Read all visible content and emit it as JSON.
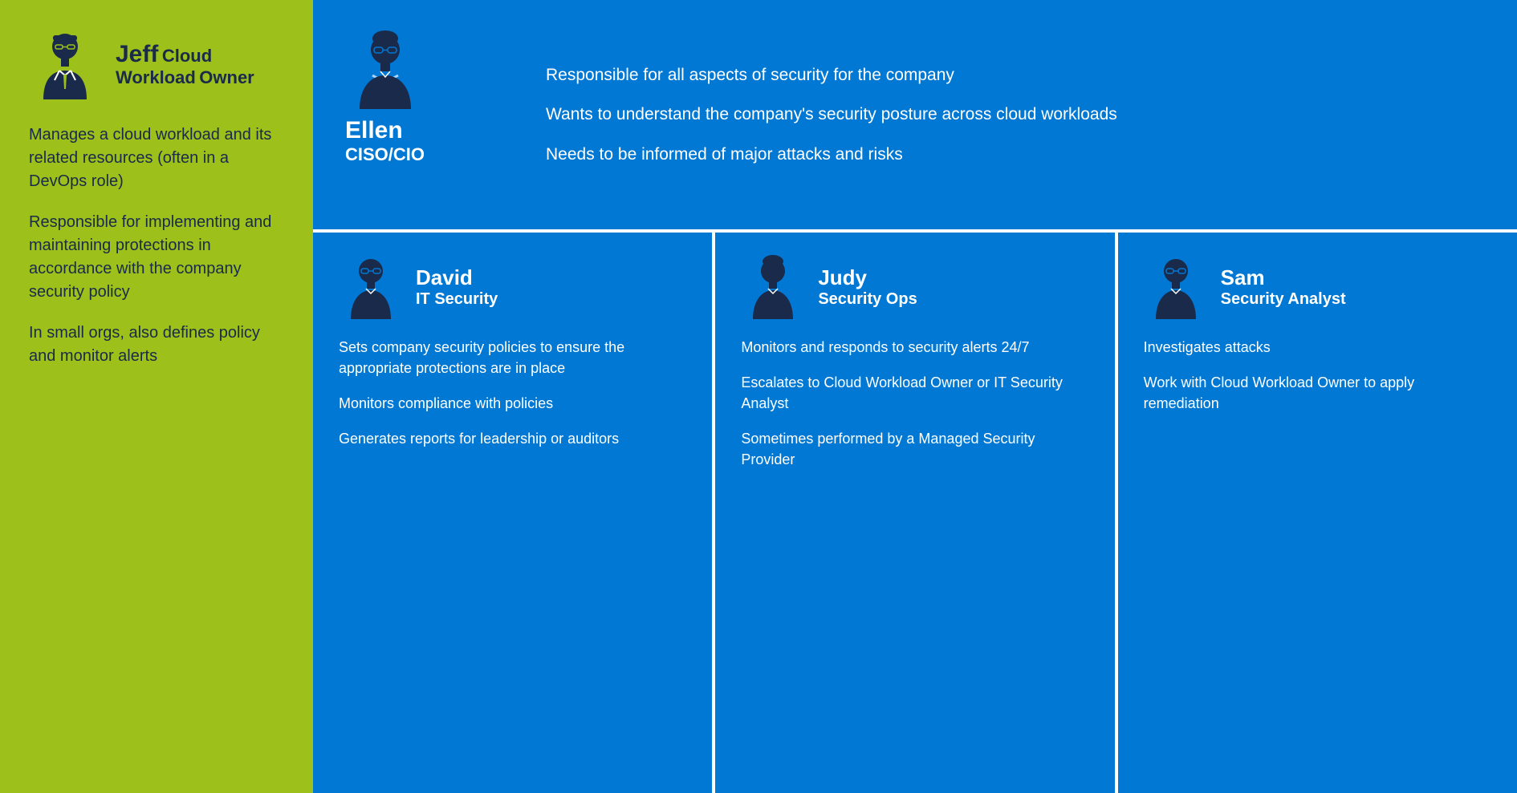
{
  "jeff": {
    "name": "Jeff",
    "role_line1": "Cloud Workload",
    "role_line2": "Owner",
    "desc1": "Manages a cloud workload and its related resources (often in a DevOps role)",
    "desc2": "Responsible for implementing and maintaining protections in accordance with the company security policy",
    "desc3": "In small orgs, also defines policy and monitor alerts"
  },
  "ellen": {
    "name": "Ellen",
    "role": "CISO/CIO",
    "desc1": "Responsible for all aspects of security for the company",
    "desc2": "Wants to understand the company's security posture across cloud workloads",
    "desc3": "Needs to be informed of major attacks and risks"
  },
  "david": {
    "name": "David",
    "role": "IT Security",
    "desc1": "Sets company security policies to ensure the appropriate protections are in place",
    "desc2": "Monitors compliance with policies",
    "desc3": "Generates reports for leadership or auditors"
  },
  "judy": {
    "name": "Judy",
    "role": "Security Ops",
    "desc1": "Monitors and responds to security alerts 24/7",
    "desc2": "Escalates to Cloud Workload Owner or IT Security Analyst",
    "desc3": "Sometimes performed by a Managed Security Provider"
  },
  "sam": {
    "name": "Sam",
    "role": "Security Analyst",
    "desc1": "Investigates attacks",
    "desc2": "Work with Cloud Workload Owner to apply remediation"
  }
}
